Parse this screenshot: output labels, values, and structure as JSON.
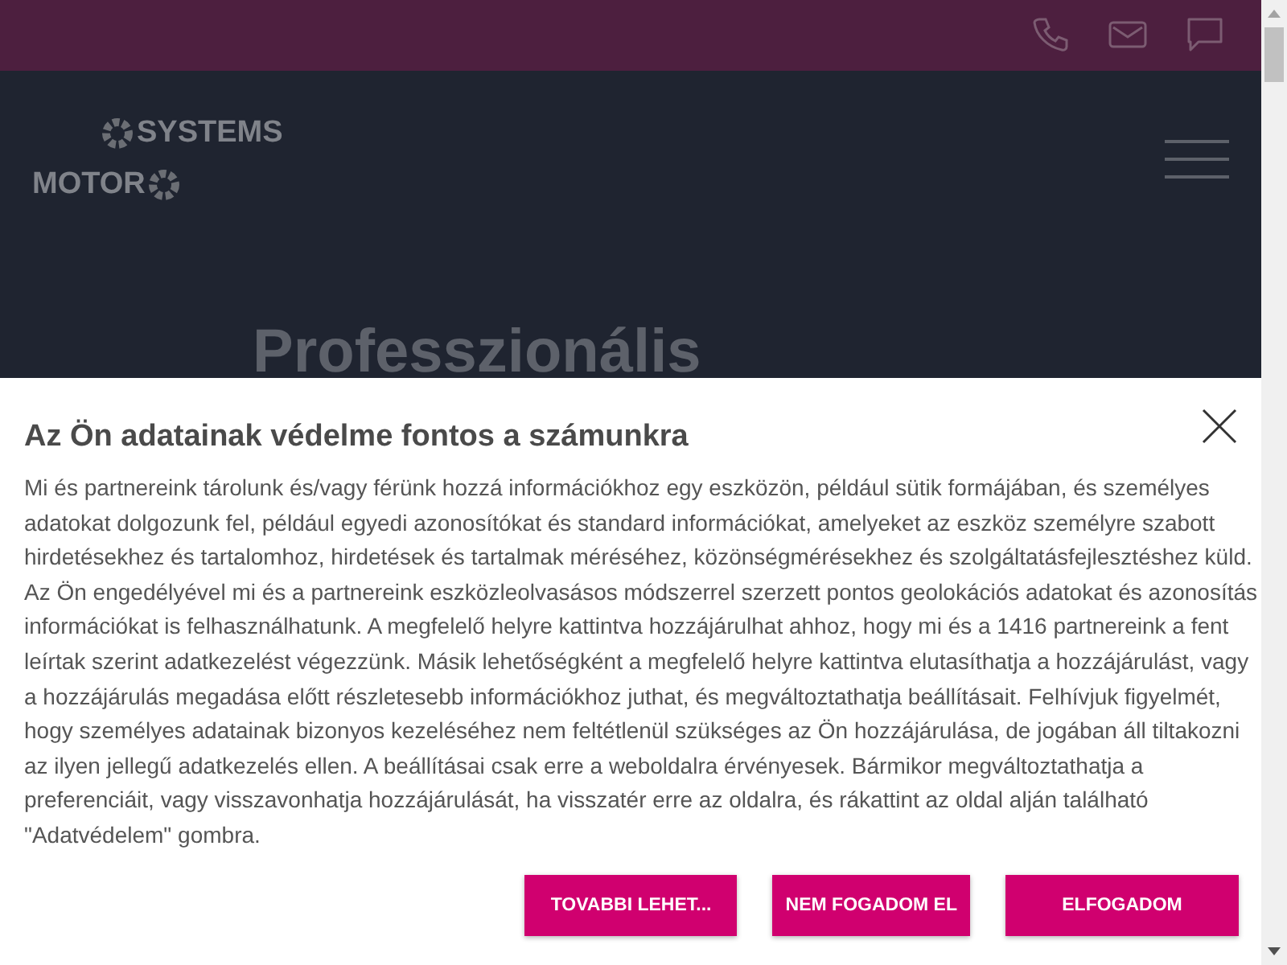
{
  "header": {
    "logo": {
      "line_1": "SYSTEMS",
      "line_2": "MOTOR"
    }
  },
  "hero": {
    "title": "Professzionális"
  },
  "consent_dialog": {
    "title": "Az Ön adatainak védelme fontos a számunkra",
    "lines": [
      "Mi és partnereink tárolunk és/vagy férünk hozzá információkhoz egy eszközön, például sütik formájában, és személyes",
      "adatokat dolgozunk fel, például egyedi azonosítókat és standard információkat, amelyeket az eszköz személyre szabott",
      "hirdetésekhez és tartalomhoz, hirdetések és tartalmak méréséhez, közönségmérésekhez és szolgáltatásfejlesztéshez küld.",
      "Az Ön engedélyével mi és a partnereink eszközleolvasásos módszerrel szerzett pontos geolokációs adatokat és azonosítás",
      "információkat is felhasználhatunk. A megfelelő helyre kattintva hozzájárulhat ahhoz, hogy mi és a 1416 partnereink a fent",
      "leírtak szerint adatkezelést végezzünk. Másik lehetőségként a megfelelő helyre kattintva elutasíthatja a hozzájárulást, vagy",
      "a hozzájárulás megadása előtt részletesebb információkhoz juthat, és megváltoztathatja beállításait. Felhívjuk figyelmét,",
      "hogy személyes adatainak bizonyos kezeléséhez nem feltétlenül szükséges az Ön hozzájárulása, de jogában áll tiltakozni",
      "az ilyen jellegű adatkezelés ellen. A beállításai csak erre a weboldalra érvényesek. Bármikor megváltoztathatja a",
      "preferenciáit, vagy visszavonhatja hozzájárulását, ha visszatér erre az oldalra, és rákattint az oldal alján található",
      "\"Adatvédelem\" gombra."
    ],
    "buttons": [
      "TOVABBI LEHET...",
      "NEM FOGADOM EL",
      "ELFOGADOM"
    ]
  }
}
